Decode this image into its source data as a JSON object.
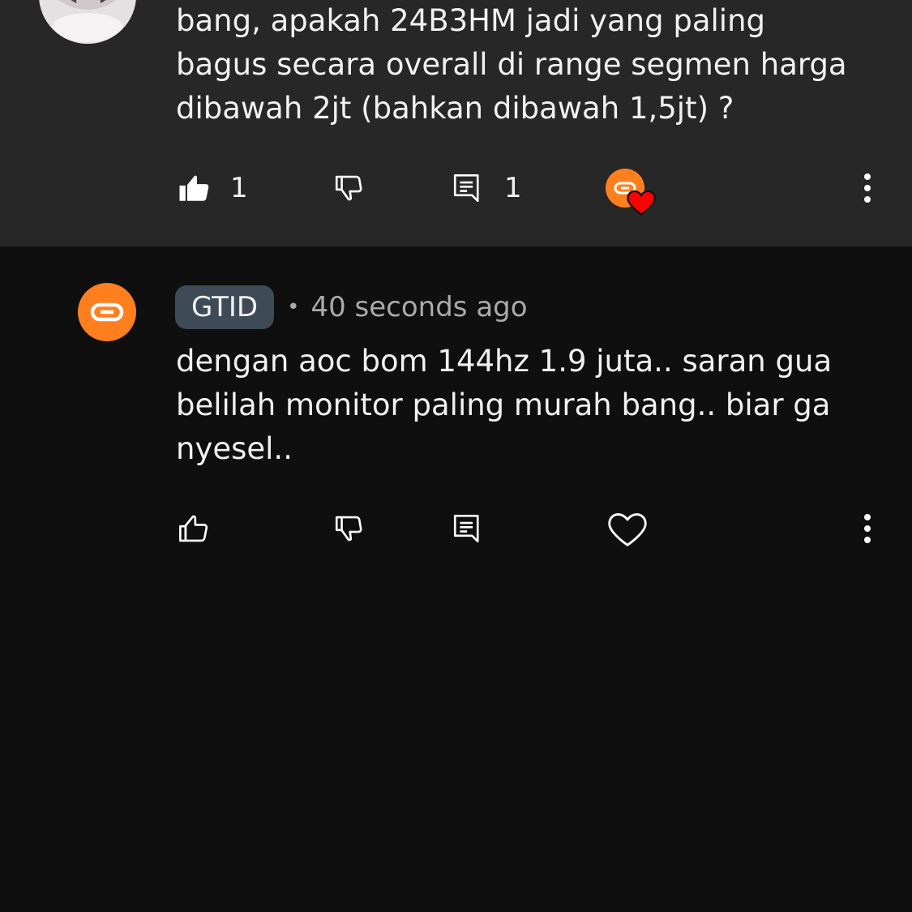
{
  "parent_comment": {
    "text": "bang, apakah 24B3HM jadi yang paling\nbagus secara overall di range segmen harga\ndibawah 2jt (bahkan dibawah 1,5jt) ?",
    "like_count": "1",
    "reply_count": "1"
  },
  "reply_comment": {
    "author": "GTID",
    "separator": "•",
    "timestamp": "40 seconds ago",
    "text": "dengan aoc bom 144hz 1.9 juta.. saran gua\nbelilah monitor paling murah bang.. biar ga\nnyesel.."
  },
  "icons": {
    "like": "thumbs-up-icon",
    "dislike": "thumbs-down-icon",
    "reply": "comment-reply-icon",
    "heart": "heart-icon",
    "more": "more-vertical-icon",
    "link": "link-icon"
  },
  "colors": {
    "background": "#0f0f0f",
    "highlight_background": "#272727",
    "author_chip": "#3f4a57",
    "creator_avatar": "#ff7f1f",
    "heart_red": "#ff0000",
    "secondary_text": "#aaaaaa"
  }
}
